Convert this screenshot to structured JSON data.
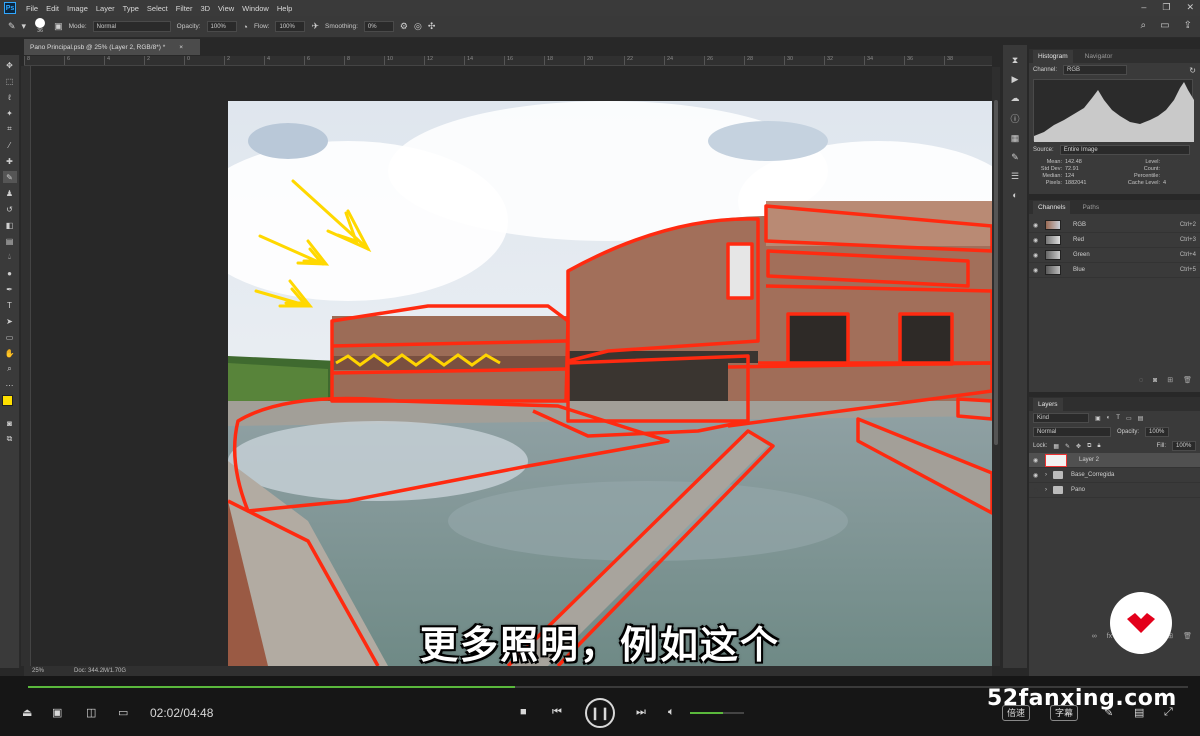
{
  "menu": [
    "File",
    "Edit",
    "Image",
    "Layer",
    "Type",
    "Select",
    "Filter",
    "3D",
    "View",
    "Window",
    "Help"
  ],
  "options": {
    "brush_size": "36",
    "mode_label": "Mode:",
    "mode_value": "Normal",
    "opacity_label": "Opacity:",
    "opacity_value": "100%",
    "flow_label": "Flow:",
    "flow_value": "100%",
    "smoothing_label": "Smoothing:",
    "smoothing_value": "0%"
  },
  "document": {
    "tab_title": "Pano Principal.psb @ 25% (Layer 2, RGB/8*) *",
    "zoom": "25%",
    "doc_info": "Doc: 344.2M/1.70G"
  },
  "ruler_ticks": [
    "8",
    "6",
    "4",
    "2",
    "0",
    "2",
    "4",
    "6",
    "8",
    "10",
    "12",
    "14",
    "16",
    "18",
    "20",
    "22",
    "24",
    "26",
    "28",
    "30",
    "32",
    "34",
    "36",
    "38"
  ],
  "histogram": {
    "tab_active": "Histogram",
    "tab_other": "Navigator",
    "channel_label": "Channel:",
    "channel_value": "RGB",
    "source_label": "Source:",
    "source_value": "Entire Image",
    "stats": [
      {
        "k": "Mean:",
        "v": "142.48",
        "k2": "Level:",
        "v2": ""
      },
      {
        "k": "Std Dev:",
        "v": "72.91",
        "k2": "Count:",
        "v2": ""
      },
      {
        "k": "Median:",
        "v": "124",
        "k2": "Percentile:",
        "v2": ""
      },
      {
        "k": "Pixels:",
        "v": "1882041",
        "k2": "Cache Level:",
        "v2": "4"
      }
    ]
  },
  "channels": {
    "tab_active": "Channels",
    "tab_other": "Paths",
    "rows": [
      {
        "name": "RGB",
        "shortcut": "Ctrl+2"
      },
      {
        "name": "Red",
        "shortcut": "Ctrl+3"
      },
      {
        "name": "Green",
        "shortcut": "Ctrl+4"
      },
      {
        "name": "Blue",
        "shortcut": "Ctrl+5"
      }
    ]
  },
  "layers": {
    "tab": "Layers",
    "kind": "Kind",
    "blend": "Normal",
    "opacity_label": "Opacity:",
    "opacity_value": "100%",
    "lock_label": "Lock:",
    "fill_label": "Fill:",
    "fill_value": "100%",
    "rows": [
      {
        "name": "Layer 2"
      },
      {
        "name": "Base_Corregida"
      },
      {
        "name": "Pano"
      }
    ]
  },
  "subtitle": "更多照明，例如这个",
  "player": {
    "time": "02:02/04:48",
    "progress": 0.42,
    "volume": 0.62,
    "speed_label": "倍速",
    "caption_label": "字幕"
  },
  "watermark": "52fanxing.com",
  "colors": {
    "foreground": "#ffe000",
    "background": "#ffffff",
    "annotation": "#ff2a10",
    "progress": "#5ab83c",
    "brand": "#e3001b"
  }
}
